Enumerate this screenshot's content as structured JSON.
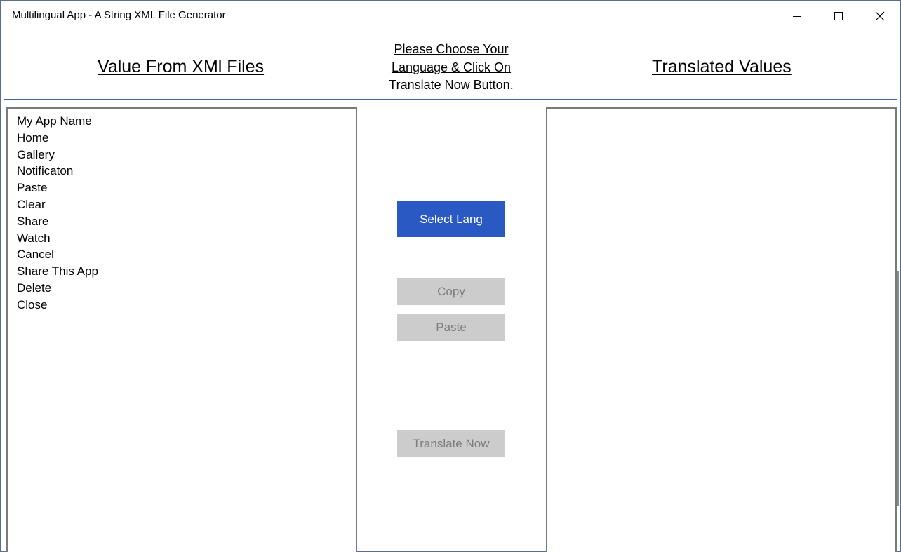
{
  "window": {
    "title": "Multilingual App - A String XML File Generator",
    "controls": [
      "minimize-icon",
      "maximize-icon",
      "close-icon"
    ]
  },
  "header": {
    "left_label": "Value From XMl Files",
    "center_lines": [
      "Please Choose Your",
      "Language & Click On",
      "Translate Now Button."
    ],
    "right_label": "Translated Values"
  },
  "source_values": [
    "My App Name",
    "Home",
    "Gallery",
    "Notificaton",
    "Paste",
    "Clear",
    "Share",
    "Watch",
    "Cancel",
    "Share This App",
    "Delete",
    "Close"
  ],
  "translated_values": [],
  "buttons": {
    "select_lang": "Select Lang",
    "copy": "Copy",
    "paste": "Paste",
    "translate_now": "Translate Now"
  },
  "colors": {
    "accent": "#2b59c3",
    "disabled_bg": "#cccccc",
    "disabled_text": "#7d7d7d",
    "divider": "#3f62b0"
  }
}
